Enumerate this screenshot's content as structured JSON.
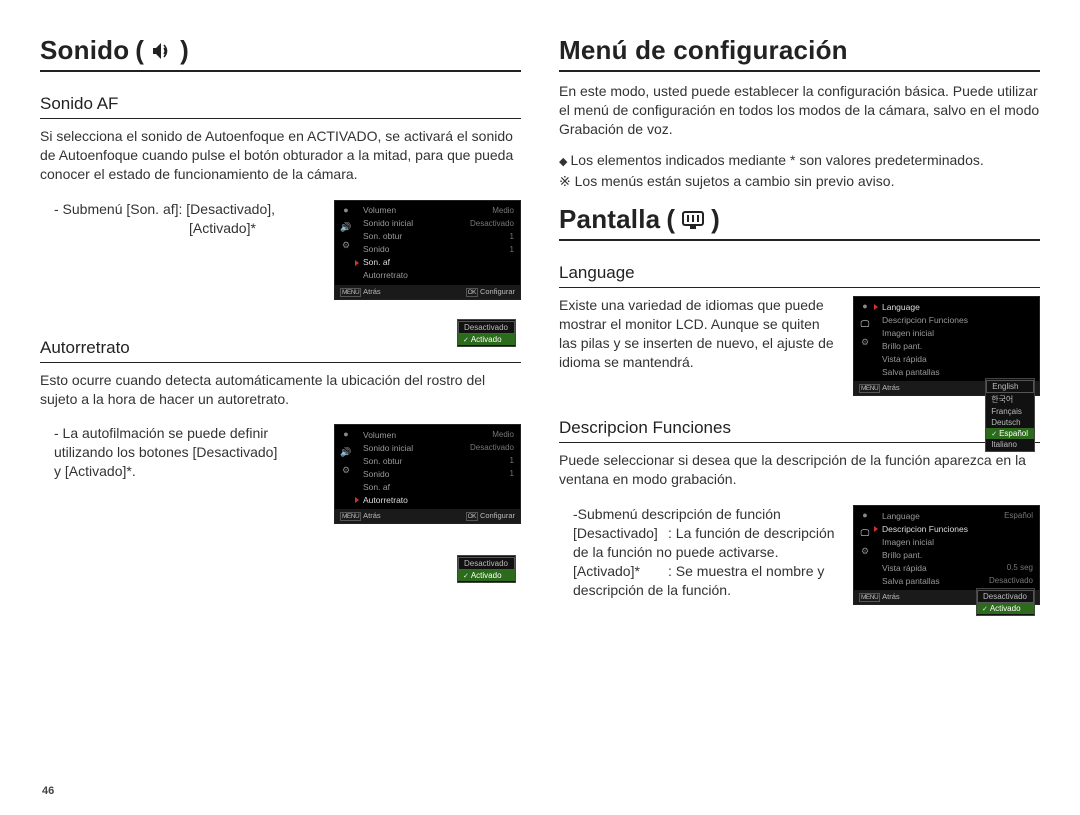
{
  "page_number": "46",
  "left": {
    "h1": "Sonido",
    "sec1": {
      "title": "Sonido AF",
      "para": "Si selecciona el sonido de Autoenfoque en ACTIVADO, se activará el sonido de Autoenfoque cuando pulse el botón obturador a la mitad, para que pueda conocer el estado de funcionamiento de la cámara.",
      "sub_line1": "- Submenú [Son. af]: [Desactivado],",
      "sub_line2": "[Activado]*"
    },
    "sec2": {
      "title": "Autorretrato",
      "para": "Esto ocurre cuando detecta automáticamente la ubicación del rostro del sujeto a la hora de hacer un autoretrato.",
      "sub_line1": "- La autofilmación se puede definir",
      "sub_line2": "utilizando los botones [Desactivado]",
      "sub_line3": "y [Activado]*."
    }
  },
  "right": {
    "h1a": "Menú de configuración",
    "para_a": "En este modo, usted puede establecer la configuración básica. Puede utilizar el menú de configuración en todos los modos de la cámara, salvo en el modo Grabación de voz.",
    "bullet1": "Los elementos indicados mediante * son valores predeterminados.",
    "bullet2": "※ Los menús están sujetos a cambio sin previo aviso.",
    "h1b": "Pantalla",
    "sec1": {
      "title": "Language",
      "para": "Existe una variedad de idiomas que puede mostrar el monitor LCD. Aunque se quiten las pilas y se inserten de nuevo, el ajuste de idioma se mantendrá."
    },
    "sec2": {
      "title": "Descripcion Funciones",
      "para": "Puede seleccionar si desea que la descripción de la función aparezca en la ventana en modo grabación.",
      "sub_intro": "-Submenú descripción de función",
      "row1_key": "[Desactivado]",
      "row1_val": ": La función de descripción de la función no puede activarse.",
      "row2_key": "[Activado]*",
      "row2_val": ": Se muestra el nombre y descripción de la función."
    }
  },
  "lcd_common": {
    "back": "Atrás",
    "set": "Configurar",
    "menu_tag": "MENU",
    "ok_tag": "OK"
  },
  "lcd1": {
    "rows": [
      {
        "label": "Volumen",
        "val": "Medio"
      },
      {
        "label": "Sonido inicial",
        "val": "Desactivado"
      },
      {
        "label": "Son. obtur",
        "val": "1"
      },
      {
        "label": "Sonido",
        "val": "1"
      },
      {
        "label": "Son. af",
        "val": "",
        "hover": true
      },
      {
        "label": "Autorretrato",
        "val": ""
      }
    ],
    "opts": [
      "Desactivado",
      "Activado"
    ],
    "sel_index": 1
  },
  "lcd2": {
    "rows": [
      {
        "label": "Volumen",
        "val": "Medio"
      },
      {
        "label": "Sonido inicial",
        "val": "Desactivado"
      },
      {
        "label": "Son. obtur",
        "val": "1"
      },
      {
        "label": "Sonido",
        "val": "1"
      },
      {
        "label": "Son. af",
        "val": ""
      },
      {
        "label": "Autorretrato",
        "val": "",
        "hover": true
      }
    ],
    "opts": [
      "Desactivado",
      "Activado"
    ],
    "sel_index": 1
  },
  "lcd3": {
    "rows": [
      {
        "label": "Language",
        "val": "",
        "hover": true
      },
      {
        "label": "Descripcion Funciones",
        "val": ""
      },
      {
        "label": "Imagen inicial",
        "val": ""
      },
      {
        "label": "Brillo pant.",
        "val": ""
      },
      {
        "label": "Vista rápida",
        "val": ""
      },
      {
        "label": "Salva pantallas",
        "val": ""
      }
    ],
    "opts": [
      "English",
      "한국어",
      "Français",
      "Deutsch",
      "Español",
      "Italiano"
    ],
    "sel_index": 4
  },
  "lcd4": {
    "rows": [
      {
        "label": "Language",
        "val": "Español"
      },
      {
        "label": "Descripcion Funciones",
        "val": "",
        "hover": true
      },
      {
        "label": "Imagen inicial",
        "val": ""
      },
      {
        "label": "Brillo pant.",
        "val": ""
      },
      {
        "label": "Vista rápida",
        "val": "0.5 seg"
      },
      {
        "label": "Salva pantallas",
        "val": "Desactivado"
      }
    ],
    "opts": [
      "Desactivado",
      "Activado"
    ],
    "sel_index": 1
  }
}
